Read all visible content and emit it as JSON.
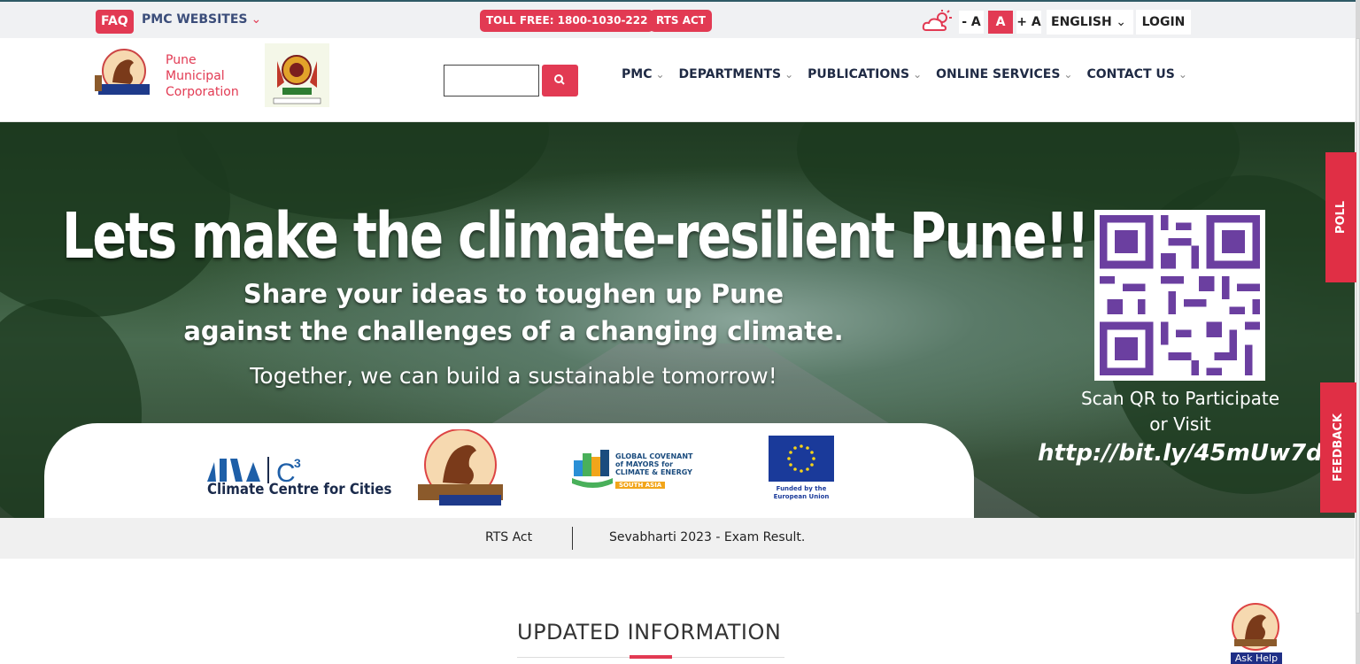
{
  "topbar": {
    "faq": "FAQ",
    "pmc_websites": "PMC WEBSITES",
    "toll_free": "TOLL FREE: 1800-1030-222",
    "rts_act": "RTS ACT",
    "font_decrease": "- A",
    "font_normal": "A",
    "font_increase": "+ A",
    "language": "ENGLISH",
    "login": "LOGIN",
    "weather_icon": "cloud-sun-icon"
  },
  "header": {
    "org_line1": "Pune",
    "org_line2": "Municipal",
    "org_line3": "Corporation",
    "search_value": "",
    "search_icon": "search-icon"
  },
  "nav": {
    "items": [
      {
        "label": "PMC"
      },
      {
        "label": "DEPARTMENTS"
      },
      {
        "label": "PUBLICATIONS"
      },
      {
        "label": "ONLINE SERVICES"
      },
      {
        "label": "CONTACT US"
      }
    ]
  },
  "hero": {
    "title": "Lets make the climate-resilient Pune!!",
    "sub1": "Share your ideas to toughen up Pune",
    "sub2": "against the challenges of a changing climate.",
    "sub3": "Together, we can build a sustainable tomorrow!",
    "scan1": "Scan QR to Participate",
    "scan2": "or Visit",
    "url": "http://bit.ly/45mUw7d",
    "partners": {
      "niua_label": "Climate Centre for Cities",
      "gcom_line1": "GLOBAL COVENANT",
      "gcom_line2": "of MAYORS for",
      "gcom_line3": "CLIMATE & ENERGY",
      "gcom_region": "SOUTH ASIA",
      "eu_label1": "Funded by the",
      "eu_label2": "European Union"
    }
  },
  "side_tabs": {
    "poll": "POLL",
    "feedback": "FEEDBACK"
  },
  "ticker": {
    "rts": "RTS Act",
    "news": "Sevabharti 2023 - Exam Result."
  },
  "updated": {
    "title": "UPDATED INFORMATION"
  },
  "ask_help": "Ask Help",
  "colors": {
    "accent": "#e23a53",
    "navy": "#1f2a44",
    "side_tab": "#e02f45"
  }
}
